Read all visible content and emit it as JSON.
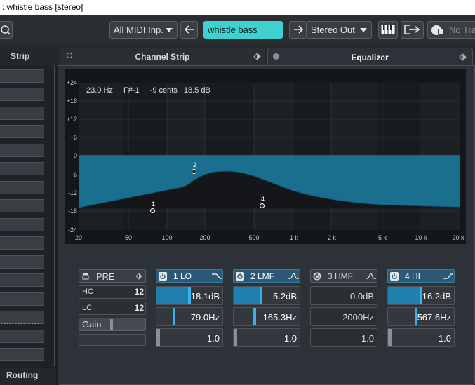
{
  "window": {
    "title": ": whistle bass [stereo]"
  },
  "toolbar": {
    "input": "All MIDI Inp.",
    "track_name": "whistle bass",
    "output": "Stereo Out",
    "no_track": "No Tra"
  },
  "panels": {
    "left_title": "Strip",
    "channel_strip": "Channel Strip",
    "equalizer": "Equalizer",
    "routing": "Routing"
  },
  "readout": {
    "freq": "23.0 Hz",
    "note": "F#-1",
    "cents": "-9 cents",
    "gain": "18.5 dB"
  },
  "y_labels": [
    "+24",
    "+18",
    "+12",
    "+6",
    "0",
    "-6",
    "-12",
    "-18",
    "-24"
  ],
  "x_labels": [
    "20",
    "50",
    "100",
    "200",
    "500",
    "1 k",
    "2 k",
    "5 k",
    "10 k",
    "20 k"
  ],
  "pre": {
    "label": "PRE",
    "hc": "HC",
    "lc": "LC",
    "gain": "Gain"
  },
  "bands": [
    {
      "label": "1 LO",
      "enabled": true,
      "gain": "-18.1dB",
      "freq": "79.0Hz",
      "q": "1.0"
    },
    {
      "label": "2 LMF",
      "enabled": true,
      "gain": "-5.2dB",
      "freq": "165.3Hz",
      "q": "1.0"
    },
    {
      "label": "3 HMF",
      "enabled": false,
      "gain": "0.0dB",
      "freq": "2000Hz",
      "q": "1.0"
    },
    {
      "label": "4 HI",
      "enabled": true,
      "gain": "-16.2dB",
      "freq": "567.6Hz",
      "q": "1.0"
    }
  ],
  "handles": [
    {
      "label": "1"
    },
    {
      "label": "2"
    },
    {
      "label": "4"
    }
  ],
  "colors": {
    "accent": "#1f7fae",
    "eq_fill": "#1a6f8f",
    "background": "#1b1e22"
  }
}
